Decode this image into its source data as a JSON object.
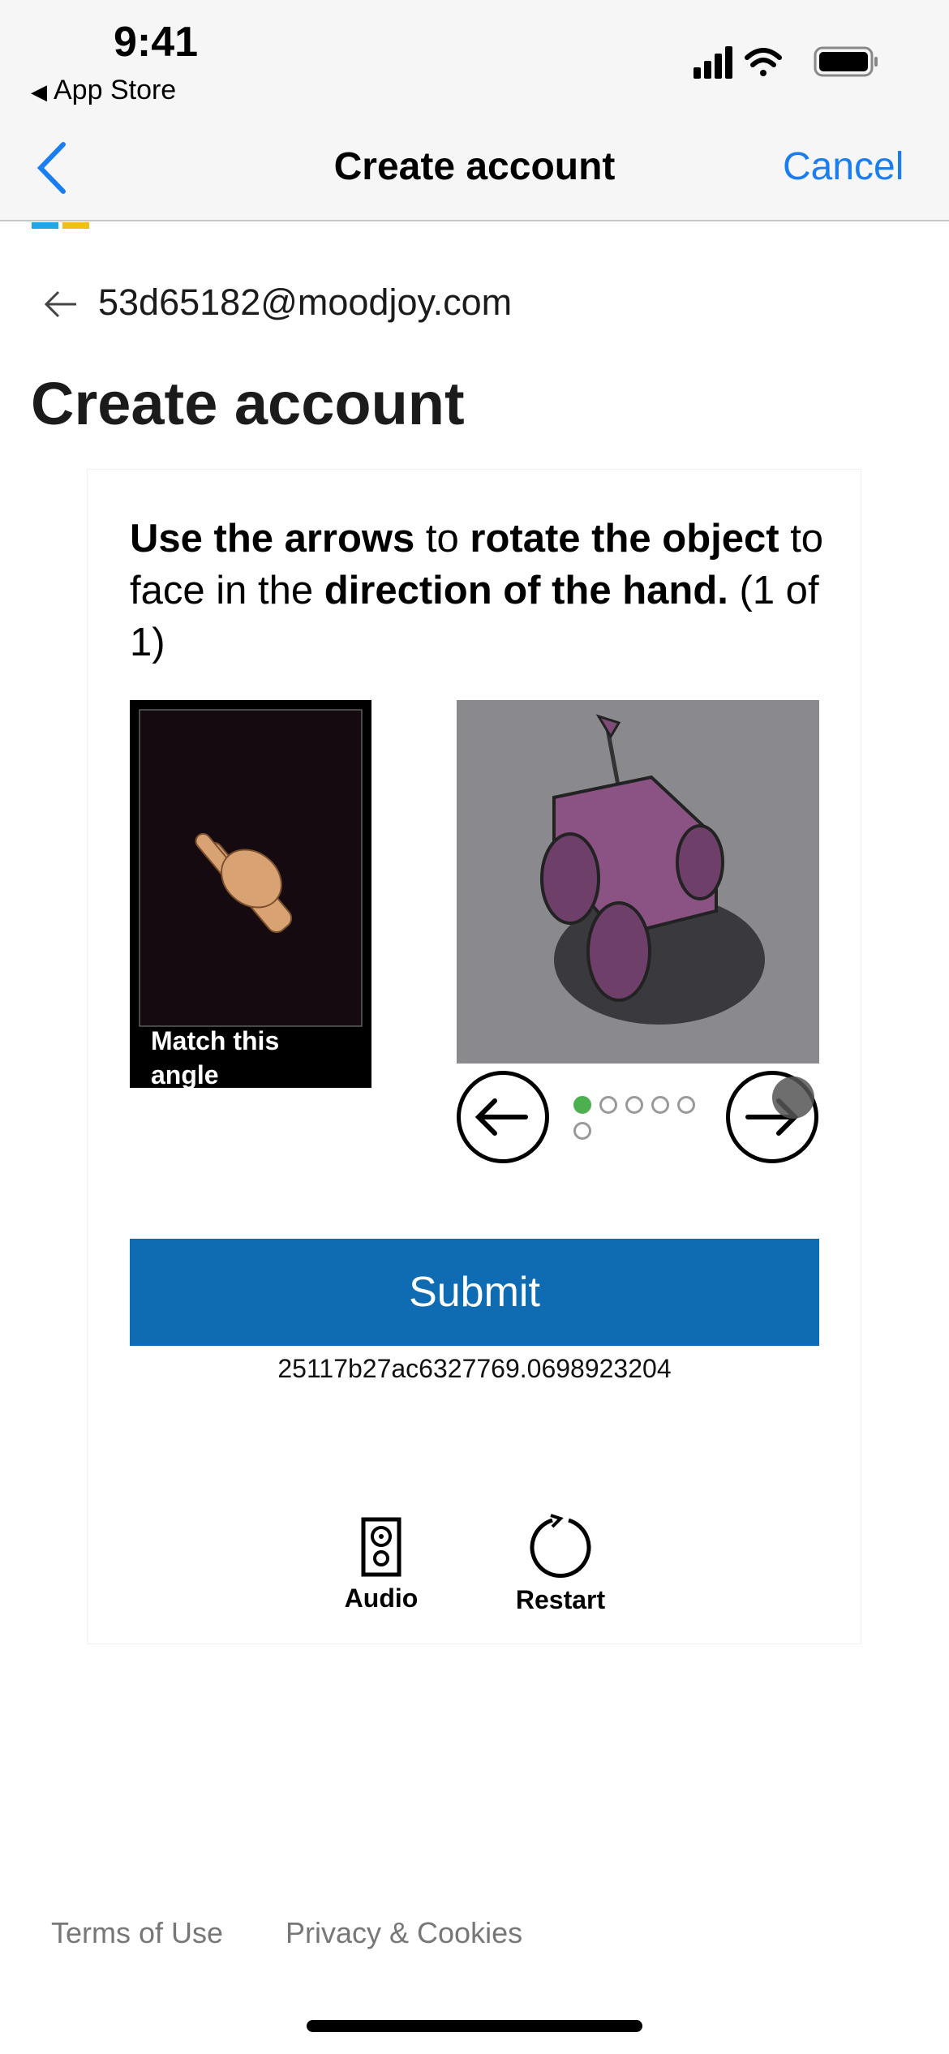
{
  "status_bar": {
    "time": "9:41",
    "back_app": "App Store"
  },
  "nav": {
    "title": "Create account",
    "cancel": "Cancel"
  },
  "email": "53d65182@moodjoy.com",
  "heading": "Create account",
  "challenge": {
    "instr_1": "Use the arrows",
    "instr_2": " to ",
    "instr_3": "rotate the object",
    "instr_4": " to face in the ",
    "instr_5": "direction of the hand.",
    "instr_6": " (1 of 1)",
    "match_label": "Match this angle",
    "dots_total": 6,
    "dots_active_index": 0
  },
  "submit_label": "Submit",
  "session_id": "25117b27ac6327769.0698923204",
  "tools": {
    "audio": "Audio",
    "restart": "Restart"
  },
  "footer": {
    "terms": "Terms of Use",
    "privacy": "Privacy & Cookies"
  },
  "colors": {
    "accent": "#0f6cb3",
    "ios_blue": "#1a7ef0",
    "active_dot": "#4caf50"
  }
}
